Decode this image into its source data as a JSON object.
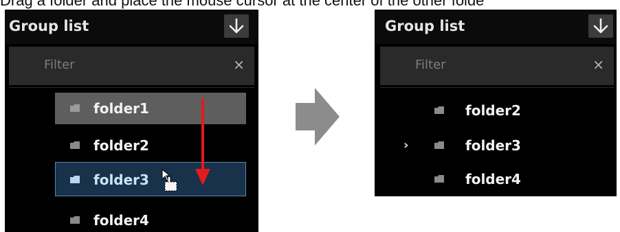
{
  "caption": "Drag a folder and place the mouse cursor at the center of the other folde",
  "left_panel": {
    "title": "Group list",
    "filter_placeholder": "Filter",
    "clear_glyph": "×",
    "folders": [
      "folder1",
      "folder2",
      "folder3",
      "folder4"
    ],
    "dragging_folder": "folder1",
    "drop_target_folder": "folder3"
  },
  "right_panel": {
    "title": "Group list",
    "filter_placeholder": "Filter",
    "clear_glyph": "×",
    "folders": [
      "folder2",
      "folder3",
      "folder4"
    ],
    "expand_chevron": "›"
  },
  "icons": {
    "download": "down-arrow-icon",
    "folder": "folder-icon",
    "cursor": "hand-cursor-icon",
    "flow_arrow": "right-arrow-icon",
    "drag_arrow": "red-down-arrow-icon"
  },
  "colors": {
    "panel_bg": "#000000",
    "filter_bg": "#2a2a2a",
    "drag_row_bg": "#5e5e5e",
    "target_row_bg": "#17324a",
    "target_row_border": "#5a89b3",
    "drag_arrow": "#e31b1b",
    "flow_arrow": "#8c8c8c"
  }
}
